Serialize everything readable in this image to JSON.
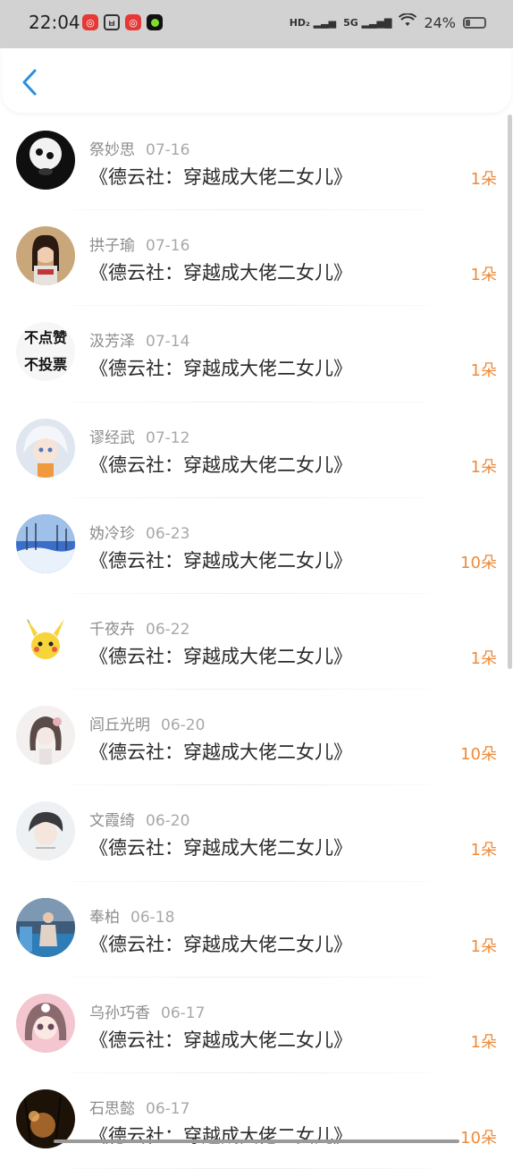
{
  "status_bar": {
    "time": "22:04",
    "network": "5G",
    "battery_percent": "24%"
  },
  "nav": {
    "back_icon": "chevron-left-icon",
    "accent": "#2b8fe0"
  },
  "colors": {
    "amount": "#ee8a3a",
    "name": "#8c8c8c",
    "title": "#2a2a2a"
  },
  "gifts": [
    {
      "name": "祭妙思",
      "date": "07-16",
      "title": "《德云社：穿越成大佬二女儿》",
      "amount": "1朵"
    },
    {
      "name": "拱子瑜",
      "date": "07-16",
      "title": "《德云社：穿越成大佬二女儿》",
      "amount": "1朵"
    },
    {
      "name": "汲芳泽",
      "date": "07-14",
      "title": "《德云社：穿越成大佬二女儿》",
      "amount": "1朵",
      "avatar_text": [
        "不点赞",
        "不投票"
      ]
    },
    {
      "name": "谬经武",
      "date": "07-12",
      "title": "《德云社：穿越成大佬二女儿》",
      "amount": "1朵"
    },
    {
      "name": "妫冷珍",
      "date": "06-23",
      "title": "《德云社：穿越成大佬二女儿》",
      "amount": "10朵"
    },
    {
      "name": "千夜卉",
      "date": "06-22",
      "title": "《德云社：穿越成大佬二女儿》",
      "amount": "1朵"
    },
    {
      "name": "闾丘光明",
      "date": "06-20",
      "title": "《德云社：穿越成大佬二女儿》",
      "amount": "10朵"
    },
    {
      "name": "文霞绮",
      "date": "06-20",
      "title": "《德云社：穿越成大佬二女儿》",
      "amount": "1朵"
    },
    {
      "name": "奉柏",
      "date": "06-18",
      "title": "《德云社：穿越成大佬二女儿》",
      "amount": "1朵"
    },
    {
      "name": "乌孙巧香",
      "date": "06-17",
      "title": "《德云社：穿越成大佬二女儿》",
      "amount": "1朵"
    },
    {
      "name": "石思懿",
      "date": "06-17",
      "title": "《德云社：穿越成大佬二女儿》",
      "amount": "10朵"
    }
  ]
}
